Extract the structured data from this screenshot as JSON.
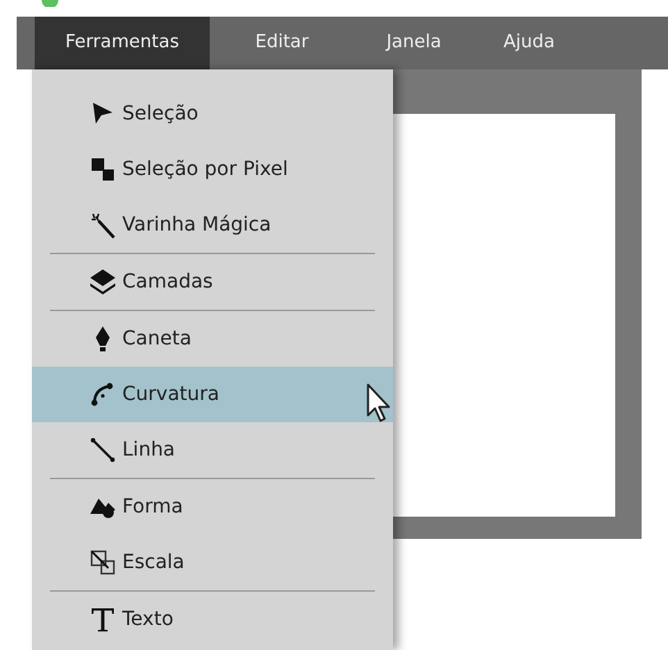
{
  "menubar": [
    {
      "label": "Ferramentas",
      "selected": true
    },
    {
      "label": "Editar",
      "selected": false
    },
    {
      "label": "Janela",
      "selected": false
    },
    {
      "label": "Ajuda",
      "selected": false
    }
  ],
  "menu": {
    "groups": [
      {
        "items": [
          {
            "label": "Seleção",
            "selected": false
          },
          {
            "label": "Seleção por Pixel",
            "selected": false
          },
          {
            "label": "Varinha Mágica",
            "selected": false
          }
        ]
      },
      {
        "items": [
          {
            "label": "Camadas",
            "selected": false
          }
        ]
      },
      {
        "items": [
          {
            "label": "Caneta",
            "selected": false
          },
          {
            "label": "Curvatura",
            "selected": true
          },
          {
            "label": "Linha",
            "selected": false
          }
        ]
      },
      {
        "items": [
          {
            "label": "Forma",
            "selected": false
          },
          {
            "label": "Escala",
            "selected": false
          }
        ]
      },
      {
        "items": [
          {
            "label": "Texto",
            "selected": false
          }
        ]
      }
    ]
  }
}
